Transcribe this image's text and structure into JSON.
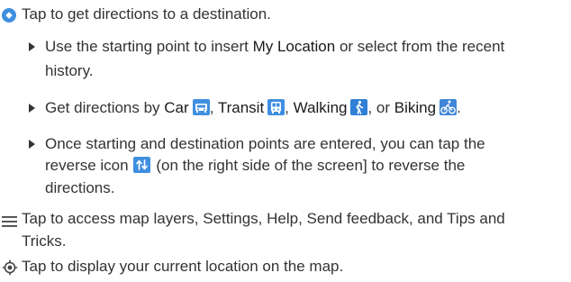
{
  "colors": {
    "accent_blue": "#3f8fe0",
    "walk_blue": "#2f7fd6",
    "bike_blue": "#3f86d8",
    "text": "#333333"
  },
  "icons": [
    "directions-icon",
    "car-icon",
    "transit-icon",
    "walking-icon",
    "biking-icon",
    "reverse-icon",
    "menu-icon",
    "my-location-icon"
  ],
  "items": {
    "directions": {
      "text": "Tap to get directions to a destination."
    },
    "sub1": {
      "line1_a": "Use the starting point to insert ",
      "line1_bold": "My Location",
      "line1_b": " or select from the recent",
      "line2": "history."
    },
    "sub2": {
      "pre": "Get directions by ",
      "car": "Car",
      "sep1": ",",
      "transit": "Transit",
      "sep2": ",",
      "walking": "Walking",
      "sep3": ", or",
      "biking": "Biking",
      "end": "."
    },
    "sub3": {
      "line1": "Once starting and destination points are entered, you can tap the",
      "line2_a": "reverse icon",
      "line2_b": " (on the right side of the screen] to reverse the",
      "line3": "directions."
    },
    "menu": {
      "line1": "Tap to access map layers, Settings, Help, Send feedback, and Tips and",
      "line2": "Tricks."
    },
    "location": {
      "text": "Tap to display your current location on the map."
    }
  }
}
